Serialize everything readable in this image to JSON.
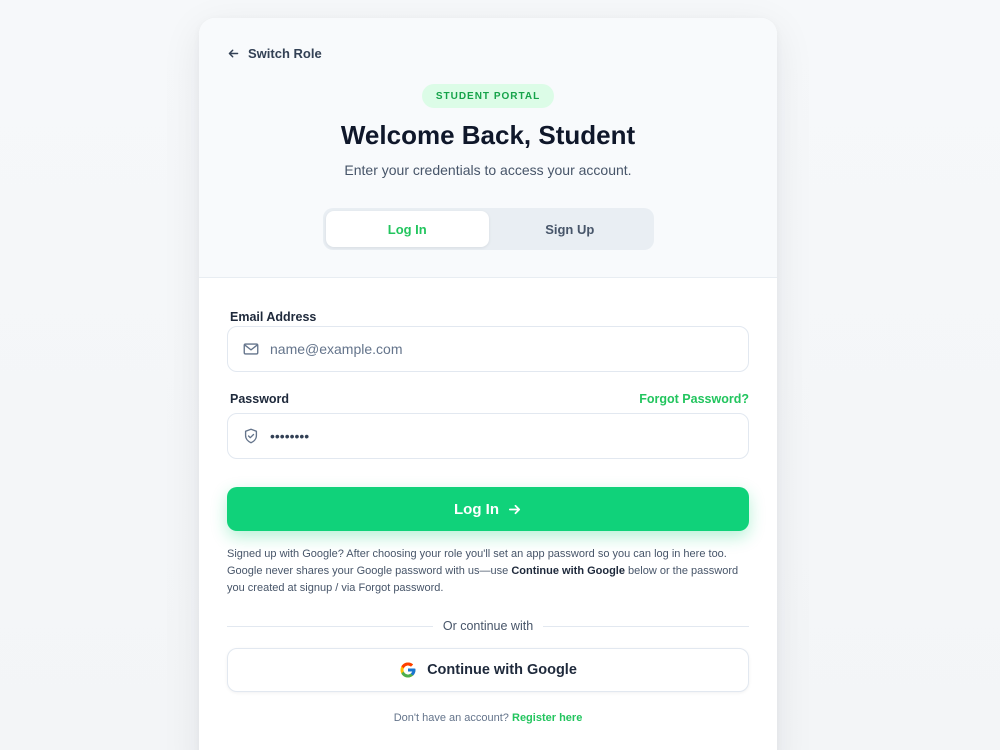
{
  "header": {
    "switch_role_label": "Switch Role",
    "badge": "STUDENT PORTAL",
    "title": "Welcome Back, Student",
    "subtitle": "Enter your credentials to access your account."
  },
  "tabs": [
    {
      "label": "Log In",
      "active": true
    },
    {
      "label": "Sign Up",
      "active": false
    }
  ],
  "form": {
    "email_label": "Email Address",
    "email_placeholder": "name@example.com",
    "email_value": "",
    "password_label": "Password",
    "password_value": "password",
    "forgot_label": "Forgot Password?",
    "submit_label": "Log In"
  },
  "note": {
    "part1": "Signed up with Google? After choosing your role you'll set an app password so you can log in here too. Google never shares your Google password with us—use ",
    "bold": "Continue with Google",
    "part2": " below or the password you created at signup / via Forgot password."
  },
  "divider_text": "Or continue with",
  "google_button_label": "Continue with Google",
  "footer": {
    "prompt": "Don't have an account?",
    "link": "Register here"
  },
  "colors": {
    "accent": "#22c55e",
    "button": "#10d27a",
    "badge_bg": "#dcfce7",
    "badge_text": "#16a34a"
  },
  "icons": {
    "back": "arrow-left-icon",
    "email": "mail-icon",
    "password": "shield-check-icon",
    "submit": "arrow-right-icon",
    "google": "google-icon"
  }
}
